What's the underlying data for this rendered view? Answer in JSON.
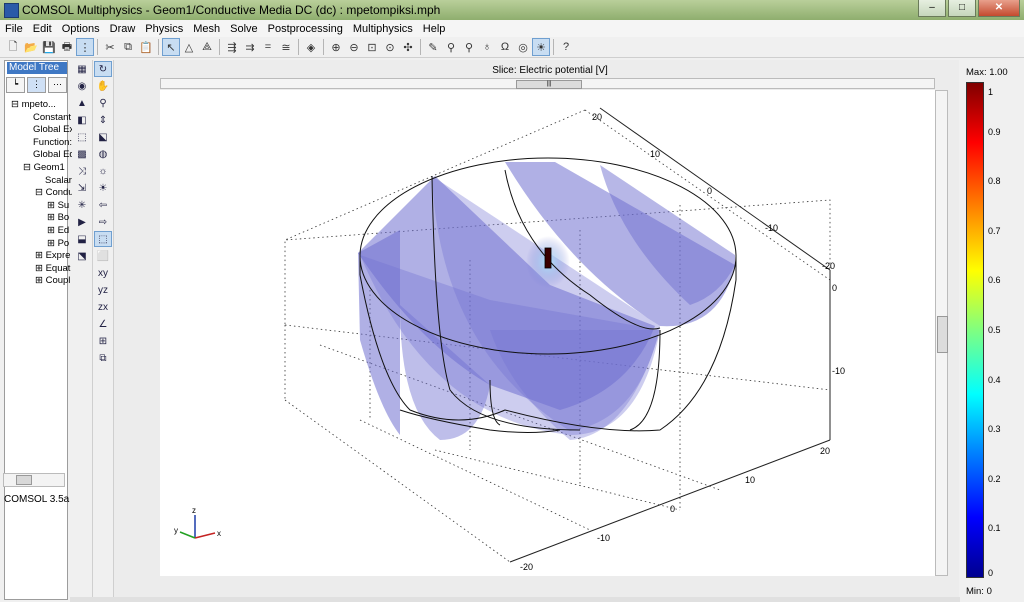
{
  "window": {
    "title": "COMSOL Multiphysics - Geom1/Conductive Media DC (dc) : mpetompiksi.mph",
    "buttons": {
      "minimize": "–",
      "maximize": "□",
      "close": "✕"
    }
  },
  "menu": [
    "File",
    "Edit",
    "Options",
    "Draw",
    "Physics",
    "Mesh",
    "Solve",
    "Postprocessing",
    "Multiphysics",
    "Help"
  ],
  "model_tree": {
    "tab_label": "Model Tree",
    "items": [
      "⊟ mpeto...",
      "Constant",
      "Global Ex",
      "Function:",
      "Global Eq",
      "⊟ Geom1",
      "Scalar",
      "⊟ Condu",
      "⊞ Su",
      "⊞ Bo",
      "⊞ Ed",
      "⊞ Po",
      "⊞ Expre",
      "⊞ Equat",
      "⊞ Coupl"
    ],
    "version": "COMSOL 3.5a"
  },
  "plot": {
    "title": "Slice: Electric potential [V]",
    "x_ticks": [
      "-20",
      "-10",
      "0",
      "10",
      "20"
    ],
    "y_ticks": [
      "20",
      "10",
      "0",
      "-10",
      "-20"
    ],
    "z_ticks": [
      "0",
      "-10"
    ],
    "triad": {
      "x": "x",
      "y": "y",
      "z": "z"
    },
    "slice_color": "#6f6fd0"
  },
  "colorbar": {
    "max_label": "Max: 1.00",
    "min_label": "Min: 0",
    "ticks": [
      "1",
      "0.9",
      "0.8",
      "0.7",
      "0.6",
      "0.5",
      "0.4",
      "0.3",
      "0.2",
      "0.1",
      "0"
    ]
  }
}
